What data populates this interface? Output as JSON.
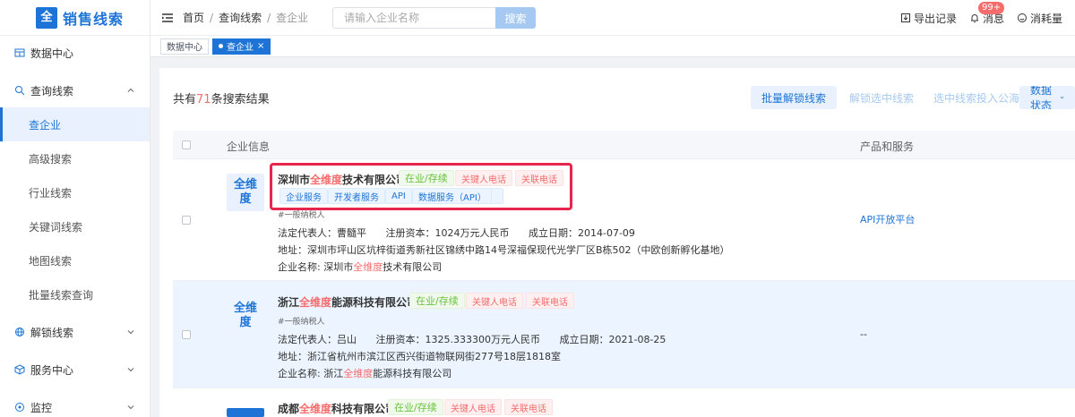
{
  "app": {
    "logo_icon": "全",
    "title": "销售线索"
  },
  "sidebar": {
    "items": [
      {
        "label": "数据中心",
        "icon": "database-icon"
      },
      {
        "label": "查询线索",
        "icon": "query-icon",
        "expanded": true,
        "children": [
          {
            "label": "查企业",
            "active": true
          },
          {
            "label": "高级搜索"
          },
          {
            "label": "行业线索"
          },
          {
            "label": "关键词线索"
          },
          {
            "label": "地图线索"
          },
          {
            "label": "批量线索查询"
          }
        ]
      },
      {
        "label": "解锁线索",
        "icon": "globe-icon"
      },
      {
        "label": "服务中心",
        "icon": "box-icon"
      },
      {
        "label": "监控",
        "icon": "monitor-icon"
      }
    ]
  },
  "header": {
    "breadcrumb": [
      "首页",
      "查询线索",
      "查企业"
    ],
    "search": {
      "placeholder": "请输入企业名称",
      "button": "搜索"
    },
    "export": "导出记录",
    "messages": "消息",
    "message_badge": "99+",
    "usage": "消耗量"
  },
  "tabs": [
    {
      "label": "数据中心",
      "active": false
    },
    {
      "label": "查企业",
      "active": true,
      "close": "×"
    }
  ],
  "results": {
    "prefix": "共有",
    "count": "71",
    "suffix": "条搜索结果",
    "actions": [
      "批量解锁线索",
      "解锁选中线索",
      "选中线索投入公海",
      "数据状态"
    ]
  },
  "table": {
    "headers": [
      "企业信息",
      "产品和服务"
    ],
    "rows": [
      {
        "logo_top": "全维",
        "logo_bottom": "度",
        "name_pre": "深圳市",
        "name_hl": "全维度",
        "name_post": "技术有限公司",
        "status": "在业/存续",
        "tags_red": [
          "关键人电话",
          "关联电话"
        ],
        "tags_blue": [
          "企业服务",
          "开发者服务",
          "API",
          "数据服务（API）",
          ""
        ],
        "taxpayer": "#一般纳税人",
        "legal_label": "法定代表人：",
        "legal": "曹髓平",
        "capital_label": "注册资本：",
        "capital": "1024万元人民币",
        "founded_label": "成立日期：",
        "founded": "2014-07-09",
        "address_label": "地址：",
        "address": "深圳市坪山区坑梓街道秀新社区锦绣中路14号深福保现代光学厂区B栋502（中欧创新孵化基地）",
        "fullname_label": "企业名称:",
        "fullname_pre": "深圳市",
        "fullname_hl": "全维度",
        "fullname_post": "技术有限公司",
        "product": "API开放平台"
      },
      {
        "logo_top": "全维",
        "logo_bottom": "度",
        "name_pre": "浙江",
        "name_hl": "全维度",
        "name_post": "能源科技有限公司",
        "status": "在业/存续",
        "tags_red": [
          "关键人电话",
          "关联电话"
        ],
        "taxpayer": "#一般纳税人",
        "legal_label": "法定代表人：",
        "legal": "吕山",
        "capital_label": "注册资本：",
        "capital": "1325.333300万元人民币",
        "founded_label": "成立日期：",
        "founded": "2021-08-25",
        "address_label": "地址：",
        "address": "浙江省杭州市滨江区西兴街道物联网街277号18层1818室",
        "fullname_label": "企业名称:",
        "fullname_pre": "浙江",
        "fullname_hl": "全维度",
        "fullname_post": "能源科技有限公司",
        "product": "--"
      },
      {
        "name_pre": "成都",
        "name_hl": "全维度",
        "name_post": "科技有限公司",
        "status": "在业/存续",
        "tags_red": [
          "关键人电话",
          "关联电话"
        ]
      }
    ]
  },
  "colors": {
    "primary": "#1d74d6",
    "highlight": "#f56c6c",
    "annotation_box": "#e8264c"
  }
}
